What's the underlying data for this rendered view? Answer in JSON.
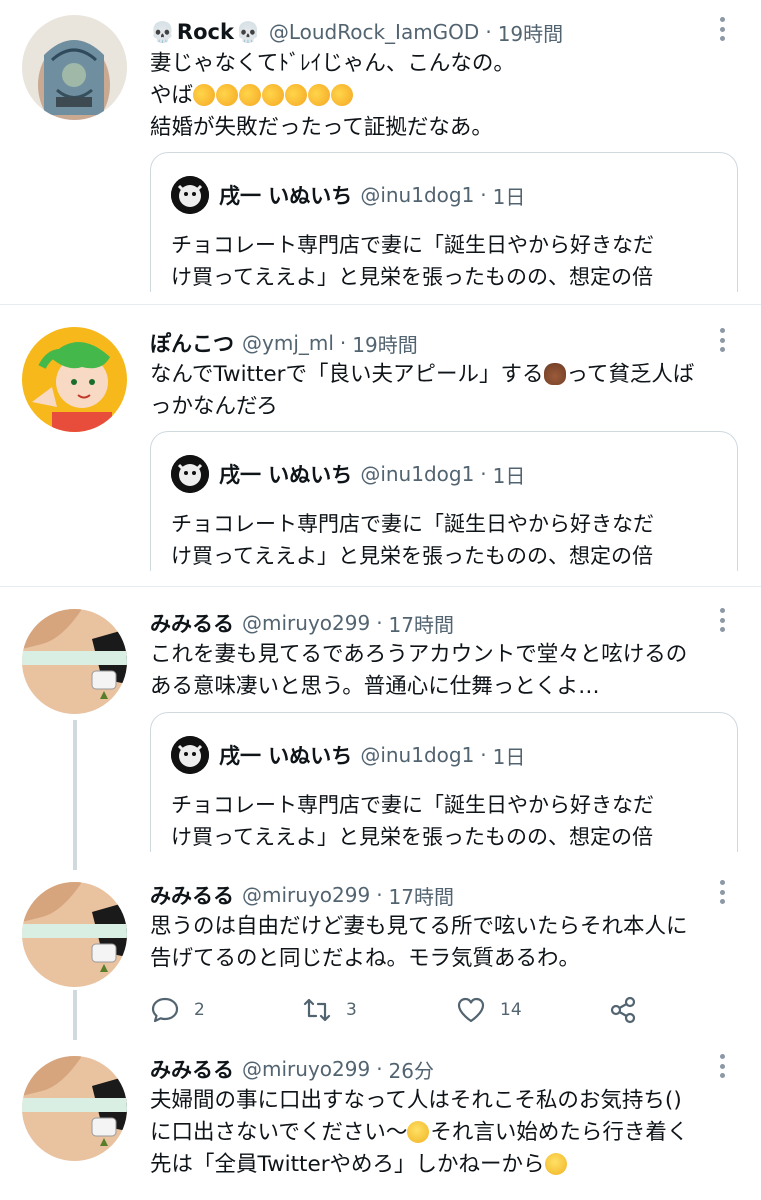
{
  "tweets": [
    {
      "display_name": "Rock",
      "handle": "@LoudRock_IamGOD",
      "separator": "·",
      "time": "19時間",
      "lines": [
        "妻じゃなくてﾄﾞﾚｲじゃん、こんなの。",
        "やば",
        "結婚が失敗だったって証拠だなあ。"
      ],
      "emoji": {
        "name_prefix": "skull-icon",
        "line2": "rolling-on-floor-laughing-icon x7"
      }
    },
    {
      "display_name": "ぽんこつ",
      "handle": "@ymj_ml",
      "separator": "·",
      "time": "19時間",
      "lines": [
        "なんでTwitterで「良い夫アピール」する",
        "って貧乏人ば",
        "っかなんだろ"
      ]
    },
    {
      "display_name": "みみるる",
      "handle": "@miruyo299",
      "separator": "·",
      "time": "17時間",
      "lines": [
        "これを妻も見てるであろうアカウントで堂々と呟けるの",
        "ある意味凄いと思う。普通心に仕舞っとくよ…"
      ]
    },
    {
      "display_name": "みみるる",
      "handle": "@miruyo299",
      "separator": "·",
      "time": "17時間",
      "lines": [
        "思うのは自由だけど妻も見てる所で呟いたらそれ本人に",
        "告げてるのと同じだよね。モラ気質あるわ。"
      ]
    },
    {
      "display_name": "みみるる",
      "handle": "@miruyo299",
      "separator": "·",
      "time": "26分",
      "lines": [
        "夫婦間の事に口出すなって人はそれこそ私のお気持ち()",
        "に口出さないでください〜",
        "それ言い始めたら行き着く",
        "先は「全員Twitterやめろ」しかねーから"
      ]
    }
  ],
  "quote": {
    "display_name": "戌一 いぬいち",
    "handle": "@inu1dog1",
    "separator": "·",
    "time": "1日",
    "lines": [
      "チョコレート専門店で妻に「誕生日やから好きなだ",
      "け買ってええよ」と見栄を張ったものの、想定の倍"
    ]
  },
  "actions": {
    "reply_count": "2",
    "retweet_count": "3",
    "like_count": "14"
  },
  "colors": {
    "text": "#0f1419",
    "secondary": "#536471",
    "border": "#cfd9de",
    "divider": "#e6ecf0"
  }
}
